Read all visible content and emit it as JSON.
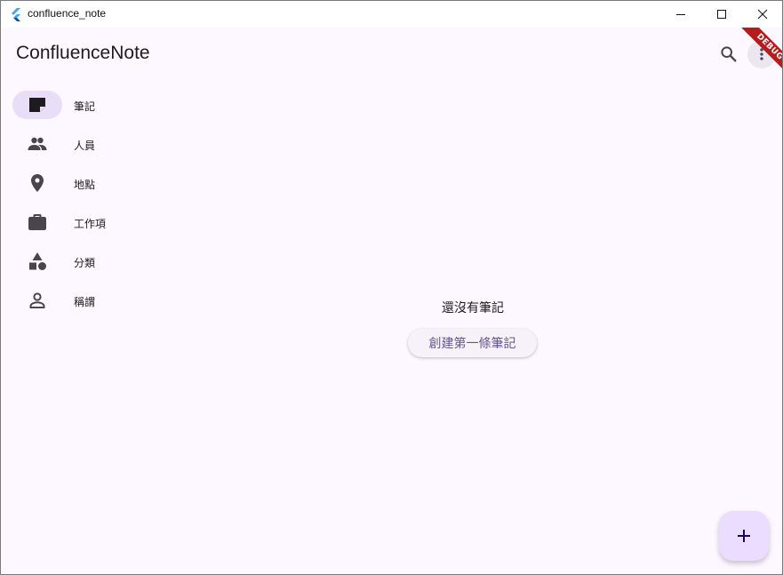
{
  "window": {
    "title": "confluence_note"
  },
  "appbar": {
    "title": "ConfluenceNote",
    "search_icon": "search-icon",
    "debug_banner": "DEBUG"
  },
  "nav": {
    "items": [
      {
        "label": "筆記",
        "icon": "note-icon",
        "selected": true
      },
      {
        "label": "人員",
        "icon": "people-icon",
        "selected": false
      },
      {
        "label": "地點",
        "icon": "place-icon",
        "selected": false
      },
      {
        "label": "工作項",
        "icon": "work-icon",
        "selected": false
      },
      {
        "label": "分類",
        "icon": "category-icon",
        "selected": false
      },
      {
        "label": "稱謂",
        "icon": "person-outline-icon",
        "selected": false
      }
    ]
  },
  "main": {
    "empty_message": "還沒有筆記",
    "create_button": "創建第一條筆記"
  },
  "fab": {
    "icon": "add-icon",
    "label": "+"
  },
  "colors": {
    "background": "#fdf7ff",
    "selected_pill": "#e8def8",
    "primary": "#65558f",
    "fab": "#eaddff",
    "icon": "#49454f"
  }
}
